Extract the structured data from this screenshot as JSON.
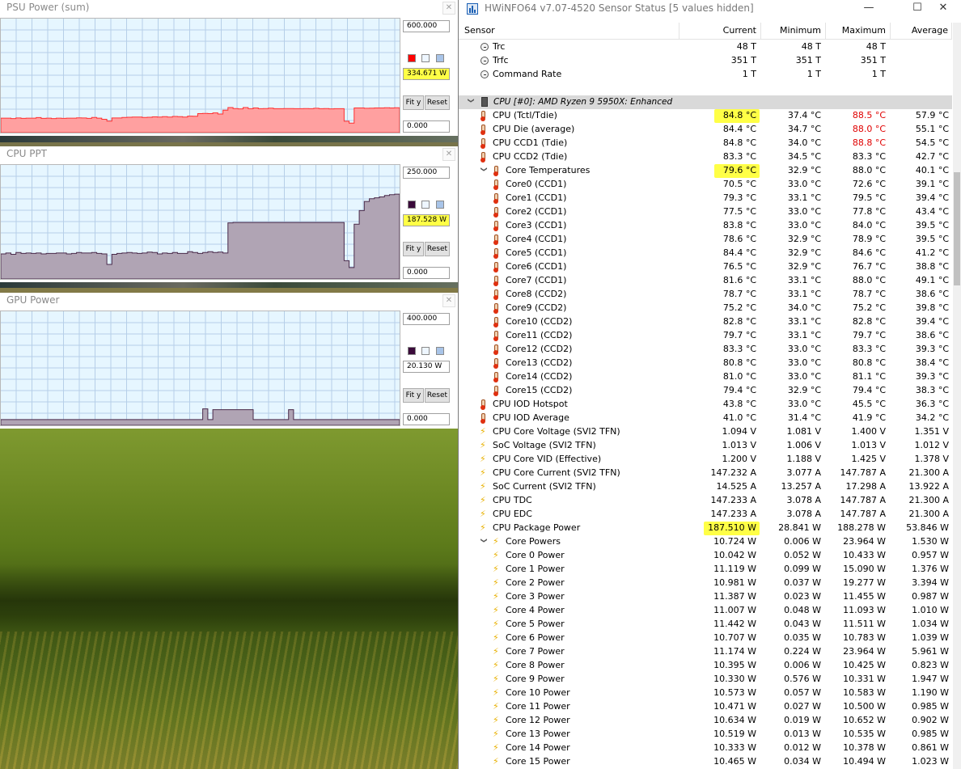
{
  "graphs": [
    {
      "title": "PSU Power (sum)",
      "max_label": "600.000",
      "current_label": "334.671 W",
      "min_label": "0.000",
      "current_highlighted": true,
      "fit_label": "Fit y",
      "reset_label": "Reset",
      "swatch_color": "#ff0000",
      "fill_color": "#ffa0a0",
      "line_color": "#ff3030",
      "scale_max": 600,
      "samples": [
        76,
        76,
        74,
        77,
        75,
        76,
        76,
        79,
        75,
        76,
        74,
        76,
        75,
        76,
        76,
        78,
        77,
        75,
        80,
        76,
        70,
        61,
        77,
        77,
        80,
        81,
        82,
        82,
        80,
        81,
        83,
        82,
        84,
        82,
        85,
        84,
        82,
        87,
        86,
        100,
        101,
        100,
        104,
        98,
        118,
        132,
        127,
        125,
        132,
        126,
        130,
        126,
        127,
        129,
        126,
        126,
        127,
        127,
        126,
        126,
        127,
        126,
        128,
        126,
        127,
        125,
        126,
        126,
        60,
        50,
        130,
        130,
        128,
        129,
        130,
        130,
        131,
        130,
        131,
        131
      ]
    },
    {
      "title": "CPU PPT",
      "max_label": "250.000",
      "current_label": "187.528 W",
      "min_label": "0.000",
      "current_highlighted": true,
      "fit_label": "Fit y",
      "reset_label": "Reset",
      "swatch_color": "#3a0a3a",
      "fill_color": "#b0a4b4",
      "line_color": "#4a2a4a",
      "scale_max": 250,
      "samples": [
        55,
        57,
        54,
        58,
        56,
        57,
        56,
        57,
        55,
        56,
        56,
        57,
        57,
        55,
        56,
        58,
        57,
        57,
        58,
        56,
        55,
        32,
        54,
        56,
        57,
        58,
        57,
        56,
        57,
        59,
        58,
        55,
        57,
        56,
        58,
        56,
        56,
        60,
        58,
        56,
        58,
        60,
        58,
        59,
        57,
        123,
        124,
        124,
        124,
        124,
        124,
        124,
        124,
        124,
        124,
        124,
        124,
        124,
        124,
        124,
        124,
        124,
        124,
        124,
        124,
        124,
        124,
        124,
        40,
        25,
        120,
        150,
        170,
        176,
        178,
        180,
        183,
        185,
        186,
        187
      ]
    },
    {
      "title": "GPU Power",
      "max_label": "400.000",
      "current_label": "20.130 W",
      "min_label": "0.000",
      "current_highlighted": false,
      "fit_label": "Fit y",
      "reset_label": "Reset",
      "swatch_color": "#3a0a3a",
      "fill_color": "#b0a4b4",
      "line_color": "#4a2a4a",
      "scale_max": 400,
      "samples": [
        20,
        20,
        20,
        20,
        20,
        20,
        20,
        20,
        20,
        20,
        20,
        20,
        20,
        20,
        20,
        20,
        20,
        20,
        20,
        20,
        20,
        20,
        20,
        20,
        20,
        20,
        20,
        20,
        20,
        20,
        20,
        20,
        20,
        20,
        20,
        20,
        20,
        20,
        20,
        20,
        58,
        20,
        55,
        55,
        55,
        55,
        55,
        55,
        55,
        55,
        20,
        20,
        20,
        20,
        20,
        20,
        20,
        55,
        20,
        20,
        20,
        20,
        20,
        20,
        20,
        20,
        20,
        20,
        20,
        20,
        20,
        20,
        20,
        20,
        20,
        20,
        20,
        20,
        20,
        20
      ]
    }
  ],
  "hwinfo": {
    "title": "HWiNFO64 v7.07-4520 Sensor Status [5 values hidden]",
    "columns": [
      "Sensor",
      "Current",
      "Minimum",
      "Maximum",
      "Average"
    ],
    "rows": [
      {
        "icon": "clock",
        "indent": 1,
        "label": "Trc",
        "cur": "48 T",
        "min": "48 T",
        "max": "48 T",
        "avg": ""
      },
      {
        "icon": "clock",
        "indent": 1,
        "label": "Trfc",
        "cur": "351 T",
        "min": "351 T",
        "max": "351 T",
        "avg": ""
      },
      {
        "icon": "clock",
        "indent": 1,
        "label": "Command Rate",
        "cur": "1 T",
        "min": "1 T",
        "max": "1 T",
        "avg": ""
      },
      {
        "icon": "",
        "indent": 0,
        "label": "",
        "cur": "",
        "min": "",
        "max": "",
        "avg": ""
      },
      {
        "icon": "chip",
        "indent": 0,
        "group": true,
        "expand": true,
        "label": "CPU [#0]: AMD Ryzen 9 5950X: Enhanced",
        "cur": "",
        "min": "",
        "max": "",
        "avg": ""
      },
      {
        "icon": "therm",
        "indent": 1,
        "label": "CPU (Tctl/Tdie)",
        "cur": "84.8 °C",
        "min": "37.4 °C",
        "max": "88.5 °C",
        "avg": "57.9 °C",
        "hl": true,
        "maxred": true
      },
      {
        "icon": "therm",
        "indent": 1,
        "label": "CPU Die (average)",
        "cur": "84.4 °C",
        "min": "34.7 °C",
        "max": "88.0 °C",
        "avg": "55.1 °C",
        "maxred": true
      },
      {
        "icon": "therm",
        "indent": 1,
        "label": "CPU CCD1 (Tdie)",
        "cur": "84.8 °C",
        "min": "34.0 °C",
        "max": "88.8 °C",
        "avg": "54.5 °C",
        "maxred": true
      },
      {
        "icon": "therm",
        "indent": 1,
        "label": "CPU CCD2 (Tdie)",
        "cur": "83.3 °C",
        "min": "34.5 °C",
        "max": "83.3 °C",
        "avg": "42.7 °C"
      },
      {
        "icon": "therm",
        "indent": 2,
        "expand": true,
        "label": "Core Temperatures",
        "cur": "79.6 °C",
        "min": "32.9 °C",
        "max": "88.0 °C",
        "avg": "40.1 °C",
        "hl": true
      },
      {
        "icon": "therm",
        "indent": 2,
        "label": "Core0 (CCD1)",
        "cur": "70.5 °C",
        "min": "33.0 °C",
        "max": "72.6 °C",
        "avg": "39.1 °C"
      },
      {
        "icon": "therm",
        "indent": 2,
        "label": "Core1 (CCD1)",
        "cur": "79.3 °C",
        "min": "33.1 °C",
        "max": "79.5 °C",
        "avg": "39.4 °C"
      },
      {
        "icon": "therm",
        "indent": 2,
        "label": "Core2 (CCD1)",
        "cur": "77.5 °C",
        "min": "33.0 °C",
        "max": "77.8 °C",
        "avg": "43.4 °C"
      },
      {
        "icon": "therm",
        "indent": 2,
        "label": "Core3 (CCD1)",
        "cur": "83.8 °C",
        "min": "33.0 °C",
        "max": "84.0 °C",
        "avg": "39.5 °C"
      },
      {
        "icon": "therm",
        "indent": 2,
        "label": "Core4 (CCD1)",
        "cur": "78.6 °C",
        "min": "32.9 °C",
        "max": "78.9 °C",
        "avg": "39.5 °C"
      },
      {
        "icon": "therm",
        "indent": 2,
        "label": "Core5 (CCD1)",
        "cur": "84.4 °C",
        "min": "32.9 °C",
        "max": "84.6 °C",
        "avg": "41.2 °C"
      },
      {
        "icon": "therm",
        "indent": 2,
        "label": "Core6 (CCD1)",
        "cur": "76.5 °C",
        "min": "32.9 °C",
        "max": "76.7 °C",
        "avg": "38.8 °C"
      },
      {
        "icon": "therm",
        "indent": 2,
        "label": "Core7 (CCD1)",
        "cur": "81.6 °C",
        "min": "33.1 °C",
        "max": "88.0 °C",
        "avg": "49.1 °C"
      },
      {
        "icon": "therm",
        "indent": 2,
        "label": "Core8 (CCD2)",
        "cur": "78.7 °C",
        "min": "33.1 °C",
        "max": "78.7 °C",
        "avg": "38.6 °C"
      },
      {
        "icon": "therm",
        "indent": 2,
        "label": "Core9 (CCD2)",
        "cur": "75.2 °C",
        "min": "34.0 °C",
        "max": "75.2 °C",
        "avg": "39.8 °C"
      },
      {
        "icon": "therm",
        "indent": 2,
        "label": "Core10 (CCD2)",
        "cur": "82.8 °C",
        "min": "33.1 °C",
        "max": "82.8 °C",
        "avg": "39.4 °C"
      },
      {
        "icon": "therm",
        "indent": 2,
        "label": "Core11 (CCD2)",
        "cur": "79.7 °C",
        "min": "33.1 °C",
        "max": "79.7 °C",
        "avg": "38.6 °C"
      },
      {
        "icon": "therm",
        "indent": 2,
        "label": "Core12 (CCD2)",
        "cur": "83.3 °C",
        "min": "33.0 °C",
        "max": "83.3 °C",
        "avg": "39.3 °C"
      },
      {
        "icon": "therm",
        "indent": 2,
        "label": "Core13 (CCD2)",
        "cur": "80.8 °C",
        "min": "33.0 °C",
        "max": "80.8 °C",
        "avg": "38.4 °C"
      },
      {
        "icon": "therm",
        "indent": 2,
        "label": "Core14 (CCD2)",
        "cur": "81.0 °C",
        "min": "33.0 °C",
        "max": "81.1 °C",
        "avg": "39.3 °C"
      },
      {
        "icon": "therm",
        "indent": 2,
        "label": "Core15 (CCD2)",
        "cur": "79.4 °C",
        "min": "32.9 °C",
        "max": "79.4 °C",
        "avg": "38.3 °C"
      },
      {
        "icon": "therm",
        "indent": 1,
        "label": "CPU IOD Hotspot",
        "cur": "43.8 °C",
        "min": "33.0 °C",
        "max": "45.5 °C",
        "avg": "36.3 °C"
      },
      {
        "icon": "therm",
        "indent": 1,
        "label": "CPU IOD Average",
        "cur": "41.0 °C",
        "min": "31.4 °C",
        "max": "41.9 °C",
        "avg": "34.2 °C"
      },
      {
        "icon": "bolt",
        "indent": 1,
        "label": "CPU Core Voltage (SVI2 TFN)",
        "cur": "1.094 V",
        "min": "1.081 V",
        "max": "1.400 V",
        "avg": "1.351 V"
      },
      {
        "icon": "bolt",
        "indent": 1,
        "label": "SoC Voltage (SVI2 TFN)",
        "cur": "1.013 V",
        "min": "1.006 V",
        "max": "1.013 V",
        "avg": "1.012 V"
      },
      {
        "icon": "bolt",
        "indent": 1,
        "label": "CPU Core VID (Effective)",
        "cur": "1.200 V",
        "min": "1.188 V",
        "max": "1.425 V",
        "avg": "1.378 V"
      },
      {
        "icon": "bolt",
        "indent": 1,
        "label": "CPU Core Current (SVI2 TFN)",
        "cur": "147.232 A",
        "min": "3.077 A",
        "max": "147.787 A",
        "avg": "21.300 A"
      },
      {
        "icon": "bolt",
        "indent": 1,
        "label": "SoC Current (SVI2 TFN)",
        "cur": "14.525 A",
        "min": "13.257 A",
        "max": "17.298 A",
        "avg": "13.922 A"
      },
      {
        "icon": "bolt",
        "indent": 1,
        "label": "CPU TDC",
        "cur": "147.233 A",
        "min": "3.078 A",
        "max": "147.787 A",
        "avg": "21.300 A"
      },
      {
        "icon": "bolt",
        "indent": 1,
        "label": "CPU EDC",
        "cur": "147.233 A",
        "min": "3.078 A",
        "max": "147.787 A",
        "avg": "21.300 A"
      },
      {
        "icon": "bolt",
        "indent": 1,
        "label": "CPU Package Power",
        "cur": "187.510 W",
        "min": "28.841 W",
        "max": "188.278 W",
        "avg": "53.846 W",
        "hl": true
      },
      {
        "icon": "bolt",
        "indent": 2,
        "expand": true,
        "label": "Core Powers",
        "cur": "10.724 W",
        "min": "0.006 W",
        "max": "23.964 W",
        "avg": "1.530 W"
      },
      {
        "icon": "bolt",
        "indent": 2,
        "label": "Core 0 Power",
        "cur": "10.042 W",
        "min": "0.052 W",
        "max": "10.433 W",
        "avg": "0.957 W"
      },
      {
        "icon": "bolt",
        "indent": 2,
        "label": "Core 1 Power",
        "cur": "11.119 W",
        "min": "0.099 W",
        "max": "15.090 W",
        "avg": "1.376 W"
      },
      {
        "icon": "bolt",
        "indent": 2,
        "label": "Core 2 Power",
        "cur": "10.981 W",
        "min": "0.037 W",
        "max": "19.277 W",
        "avg": "3.394 W"
      },
      {
        "icon": "bolt",
        "indent": 2,
        "label": "Core 3 Power",
        "cur": "11.387 W",
        "min": "0.023 W",
        "max": "11.455 W",
        "avg": "0.987 W"
      },
      {
        "icon": "bolt",
        "indent": 2,
        "label": "Core 4 Power",
        "cur": "11.007 W",
        "min": "0.048 W",
        "max": "11.093 W",
        "avg": "1.010 W"
      },
      {
        "icon": "bolt",
        "indent": 2,
        "label": "Core 5 Power",
        "cur": "11.442 W",
        "min": "0.043 W",
        "max": "11.511 W",
        "avg": "1.034 W"
      },
      {
        "icon": "bolt",
        "indent": 2,
        "label": "Core 6 Power",
        "cur": "10.707 W",
        "min": "0.035 W",
        "max": "10.783 W",
        "avg": "1.039 W"
      },
      {
        "icon": "bolt",
        "indent": 2,
        "label": "Core 7 Power",
        "cur": "11.174 W",
        "min": "0.224 W",
        "max": "23.964 W",
        "avg": "5.961 W"
      },
      {
        "icon": "bolt",
        "indent": 2,
        "label": "Core 8 Power",
        "cur": "10.395 W",
        "min": "0.006 W",
        "max": "10.425 W",
        "avg": "0.823 W"
      },
      {
        "icon": "bolt",
        "indent": 2,
        "label": "Core 9 Power",
        "cur": "10.330 W",
        "min": "0.576 W",
        "max": "10.331 W",
        "avg": "1.947 W"
      },
      {
        "icon": "bolt",
        "indent": 2,
        "label": "Core 10 Power",
        "cur": "10.573 W",
        "min": "0.057 W",
        "max": "10.583 W",
        "avg": "1.190 W"
      },
      {
        "icon": "bolt",
        "indent": 2,
        "label": "Core 11 Power",
        "cur": "10.471 W",
        "min": "0.027 W",
        "max": "10.500 W",
        "avg": "0.985 W"
      },
      {
        "icon": "bolt",
        "indent": 2,
        "label": "Core 12 Power",
        "cur": "10.634 W",
        "min": "0.019 W",
        "max": "10.652 W",
        "avg": "0.902 W"
      },
      {
        "icon": "bolt",
        "indent": 2,
        "label": "Core 13 Power",
        "cur": "10.519 W",
        "min": "0.013 W",
        "max": "10.535 W",
        "avg": "0.985 W"
      },
      {
        "icon": "bolt",
        "indent": 2,
        "label": "Core 14 Power",
        "cur": "10.333 W",
        "min": "0.012 W",
        "max": "10.378 W",
        "avg": "0.861 W"
      },
      {
        "icon": "bolt",
        "indent": 2,
        "label": "Core 15 Power",
        "cur": "10.465 W",
        "min": "0.034 W",
        "max": "10.494 W",
        "avg": "1.023 W"
      }
    ]
  }
}
